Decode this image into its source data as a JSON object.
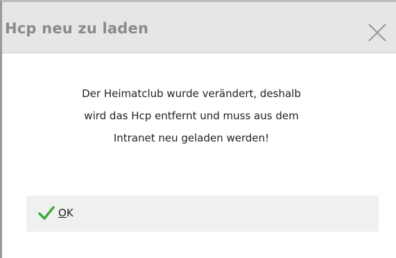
{
  "dialog": {
    "title": "Hcp neu zu laden",
    "close_icon": "close-icon",
    "message_lines": [
      "Der Heimatclub wurde verändert, deshalb",
      "wird das Hcp entfernt und muss aus dem",
      "Intranet neu geladen werden!"
    ],
    "ok_button": {
      "mnemonic": "O",
      "rest": "K",
      "icon": "check-icon"
    }
  },
  "colors": {
    "titlebar_bg": "#e6e6e6",
    "title_text": "#8a8a8a",
    "button_bg": "#f0f0f0",
    "check_green": "#3aaa35"
  }
}
